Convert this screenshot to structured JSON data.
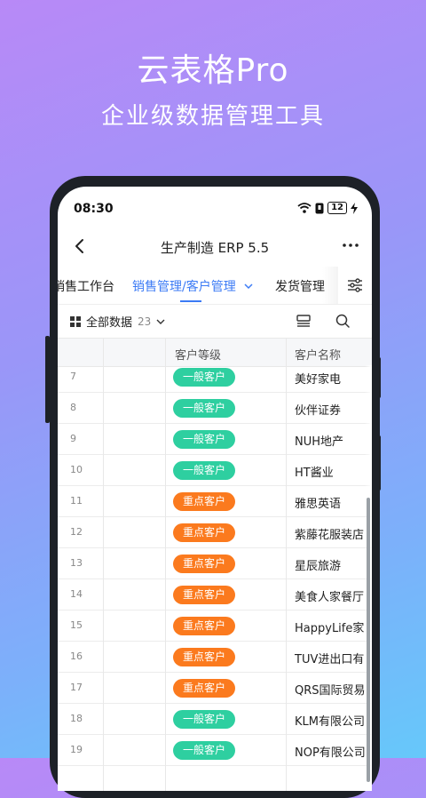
{
  "hero": {
    "title": "云表格Pro",
    "subtitle": "企业级数据管理工具"
  },
  "status_bar": {
    "time": "08:30",
    "battery": "12",
    "icons": [
      "wifi-icon",
      "sim-icon",
      "battery-icon",
      "charging-icon"
    ]
  },
  "navbar": {
    "title": "生产制造 ERP 5.5",
    "back_icon": "chevron-left-icon",
    "more_icon": "ellipsis-icon"
  },
  "tabs": [
    {
      "label": "销售工作台"
    },
    {
      "label": "销售管理/客户管理",
      "active": true
    },
    {
      "label": "发货管理"
    }
  ],
  "toolbar": {
    "view_label": "全部数据",
    "count": "23"
  },
  "table": {
    "headers": [
      "客户等级",
      "客户名称"
    ],
    "rows": [
      {
        "num": "7",
        "level": "一般客户",
        "name": "美好家电"
      },
      {
        "num": "8",
        "level": "一般客户",
        "name": "伙伴证券"
      },
      {
        "num": "9",
        "level": "一般客户",
        "name": "NUH地产"
      },
      {
        "num": "10",
        "level": "一般客户",
        "name": "HT酱业"
      },
      {
        "num": "11",
        "level": "重点客户",
        "name": "雅思英语"
      },
      {
        "num": "12",
        "level": "重点客户",
        "name": "紫藤花服装店"
      },
      {
        "num": "13",
        "level": "重点客户",
        "name": "星辰旅游"
      },
      {
        "num": "14",
        "level": "重点客户",
        "name": "美食人家餐厅"
      },
      {
        "num": "15",
        "level": "重点客户",
        "name": "HappyLife家"
      },
      {
        "num": "16",
        "level": "重点客户",
        "name": "TUV进出口有"
      },
      {
        "num": "17",
        "level": "重点客户",
        "name": "QRS国际贸易"
      },
      {
        "num": "18",
        "level": "一般客户",
        "name": "KLM有限公司"
      },
      {
        "num": "19",
        "level": "一般客户",
        "name": "NOP有限公司"
      }
    ]
  },
  "colors": {
    "normal_tag": "#2ecfa0",
    "key_tag": "#fb7a1e",
    "accent": "#3c7bf5"
  }
}
